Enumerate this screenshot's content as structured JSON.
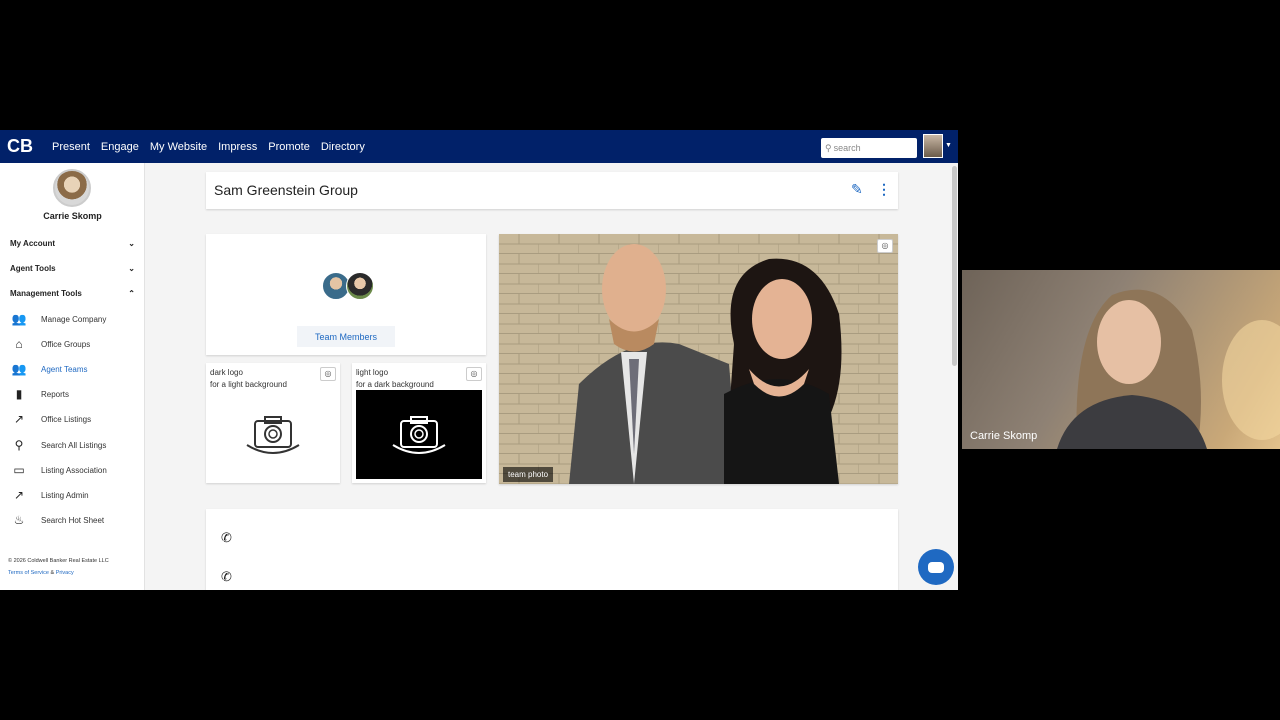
{
  "nav": {
    "logo": "CB",
    "items": [
      "Present",
      "Engage",
      "My Website",
      "Impress",
      "Promote",
      "Directory"
    ],
    "search_placeholder": "search"
  },
  "sidebar": {
    "user_name": "Carrie Skomp",
    "sections": [
      {
        "label": "My Account",
        "state": "collapsed"
      },
      {
        "label": "Agent Tools",
        "state": "collapsed"
      },
      {
        "label": "Management Tools",
        "state": "expanded"
      }
    ],
    "items": [
      {
        "label": "Manage Company",
        "icon": "people-icon"
      },
      {
        "label": "Office Groups",
        "icon": "office-groups-icon"
      },
      {
        "label": "Agent Teams",
        "icon": "agent-teams-icon",
        "active": true
      },
      {
        "label": "Reports",
        "icon": "bar-chart-icon"
      },
      {
        "label": "Office Listings",
        "icon": "trend-icon"
      },
      {
        "label": "Search All Listings",
        "icon": "search-icon"
      },
      {
        "label": "Listing Association",
        "icon": "listing-association-icon"
      },
      {
        "label": "Listing Admin",
        "icon": "trending-up-icon"
      },
      {
        "label": "Search Hot Sheet",
        "icon": "fire-icon"
      }
    ],
    "copyright": "© 2026 Coldwell Banker Real Estate LLC",
    "terms": "Terms of Service",
    "and": "&",
    "privacy": "Privacy"
  },
  "main": {
    "title": "Sam Greenstein Group",
    "members_button": "Team Members",
    "dark_logo": {
      "title": "dark logo",
      "subtitle": "for a light background"
    },
    "light_logo": {
      "title": "light logo",
      "subtitle": "for a dark background"
    },
    "photo_label": "team photo"
  },
  "video": {
    "name": "Carrie Skomp"
  },
  "colors": {
    "brand": "#012169",
    "accent": "#1f69c2"
  }
}
